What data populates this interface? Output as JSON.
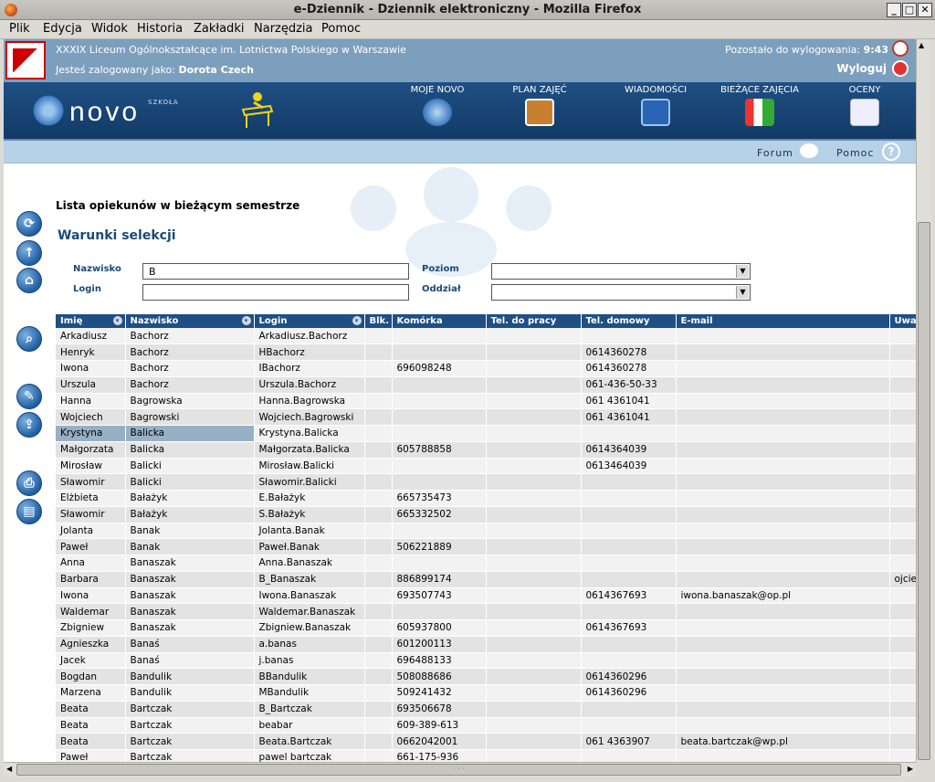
{
  "window": {
    "title": "e-Dziennik - Dziennik elektroniczny - Mozilla Firefox"
  },
  "menu": [
    "Plik",
    "Edycja",
    "Widok",
    "Historia",
    "Zakładki",
    "Narzędzia",
    "Pomoc"
  ],
  "header": {
    "school": "XXXIX Liceum Ogólnokształcące im. Lotnictwa Polskiego w Warszawie",
    "logged_prefix": "Jesteś zalogowany jako:",
    "user": "Dorota Czech",
    "timer_label": "Pozostało do wylogowania:",
    "timer_value": "9:43",
    "logout": "Wyloguj"
  },
  "logo": {
    "text": "novo",
    "sub": "SZKOŁA"
  },
  "nav": [
    {
      "label": "MOJE NOVO",
      "icon": "globe-icon"
    },
    {
      "label": "PLAN ZAJĘĆ",
      "icon": "schedule-book-icon"
    },
    {
      "label": "WIADOMOŚCI",
      "icon": "mail-book-icon"
    },
    {
      "label": "BIEŻĄCE ZAJĘCIA",
      "icon": "charts-icon"
    },
    {
      "label": "OCENY",
      "icon": "grades-icon"
    }
  ],
  "strip": {
    "forum": "Forum",
    "help": "Pomoc"
  },
  "page": {
    "title": "Lista opiekunów w bieżącym semestrze",
    "subtitle": "Warunki selekcji"
  },
  "filters": {
    "surname_label": "Nazwisko",
    "surname_value": "B",
    "login_label": "Login",
    "login_value": "",
    "level_label": "Poziom",
    "level_value": "",
    "class_label": "Oddział",
    "class_value": ""
  },
  "table": {
    "columns": [
      "Imię",
      "Nazwisko",
      "Login",
      "Blk.",
      "Komórka",
      "Tel. do pracy",
      "Tel. domowy",
      "E-mail",
      "Uwa"
    ],
    "selected_row": 6,
    "rows": [
      [
        "Arkadiusz",
        "Bachorz",
        "Arkadiusz.Bachorz",
        "",
        "",
        "",
        "",
        "",
        ""
      ],
      [
        "Henryk",
        "Bachorz",
        "HBachorz",
        "",
        "",
        "",
        "0614360278",
        "",
        ""
      ],
      [
        "Iwona",
        "Bachorz",
        "IBachorz",
        "",
        "696098248",
        "",
        "0614360278",
        "",
        ""
      ],
      [
        "Urszula",
        "Bachorz",
        "Urszula.Bachorz",
        "",
        "",
        "",
        "061-436-50-33",
        "",
        ""
      ],
      [
        "Hanna",
        "Bagrowska",
        "Hanna.Bagrowska",
        "",
        "",
        "",
        "061 4361041",
        "",
        ""
      ],
      [
        "Wojciech",
        "Bagrowski",
        "Wojciech.Bagrowski",
        "",
        "",
        "",
        "061 4361041",
        "",
        ""
      ],
      [
        "Krystyna",
        "Balicka",
        "Krystyna.Balicka",
        "",
        "",
        "",
        "",
        "",
        ""
      ],
      [
        "Małgorzata",
        "Balicka",
        "Małgorzata.Balicka",
        "",
        "605788858",
        "",
        "0614364039",
        "",
        ""
      ],
      [
        "Mirosław",
        "Balicki",
        "Mirosław.Balicki",
        "",
        "",
        "",
        "0613464039",
        "",
        ""
      ],
      [
        "Sławomir",
        "Balicki",
        "Sławomir.Balicki",
        "",
        "",
        "",
        "",
        "",
        ""
      ],
      [
        "Elżbieta",
        "Bałażyk",
        "E.Bałażyk",
        "",
        "665735473",
        "",
        "",
        "",
        ""
      ],
      [
        "Sławomir",
        "Bałażyk",
        "S.Bałażyk",
        "",
        "665332502",
        "",
        "",
        "",
        ""
      ],
      [
        "Jolanta",
        "Banak",
        "Jolanta.Banak",
        "",
        "",
        "",
        "",
        "",
        ""
      ],
      [
        "Paweł",
        "Banak",
        "Paweł.Banak",
        "",
        "506221889",
        "",
        "",
        "",
        ""
      ],
      [
        "Anna",
        "Banaszak",
        "Anna.Banaszak",
        "",
        "",
        "",
        "",
        "",
        ""
      ],
      [
        "Barbara",
        "Banaszak",
        "B_Banaszak",
        "",
        "886899174",
        "",
        "",
        "",
        "ojcie"
      ],
      [
        "Iwona",
        "Banaszak",
        "Iwona.Banaszak",
        "",
        "693507743",
        "",
        "0614367693",
        "iwona.banaszak@op.pl",
        ""
      ],
      [
        "Waldemar",
        "Banaszak",
        "Waldemar.Banaszak",
        "",
        "",
        "",
        "",
        "",
        ""
      ],
      [
        "Zbigniew",
        "Banaszak",
        "Zbigniew.Banaszak",
        "",
        "605937800",
        "",
        "0614367693",
        "",
        ""
      ],
      [
        "Agnieszka",
        "Banaś",
        "a.banas",
        "",
        "601200113",
        "",
        "",
        "",
        ""
      ],
      [
        "Jacek",
        "Banaś",
        "j.banas",
        "",
        "696488133",
        "",
        "",
        "",
        ""
      ],
      [
        "Bogdan",
        "Bandulik",
        "BBandulik",
        "",
        "508088686",
        "",
        "0614360296",
        "",
        ""
      ],
      [
        "Marzena",
        "Bandulik",
        "MBandulik",
        "",
        "509241432",
        "",
        "0614360296",
        "",
        ""
      ],
      [
        "Beata",
        "Bartczak",
        "B_Bartczak",
        "",
        "693506678",
        "",
        "",
        "",
        ""
      ],
      [
        "Beata",
        "Bartczak",
        "beabar",
        "",
        "609-389-613",
        "",
        "",
        "",
        ""
      ],
      [
        "Beata",
        "Bartczak",
        "Beata.Bartczak",
        "",
        "0662042001",
        "",
        "061 4363907",
        "beata.bartczak@wp.pl",
        ""
      ],
      [
        "Paweł",
        "Bartczak",
        "pawel bartczak",
        "",
        "661-175-936",
        "",
        "",
        "",
        ""
      ]
    ]
  }
}
